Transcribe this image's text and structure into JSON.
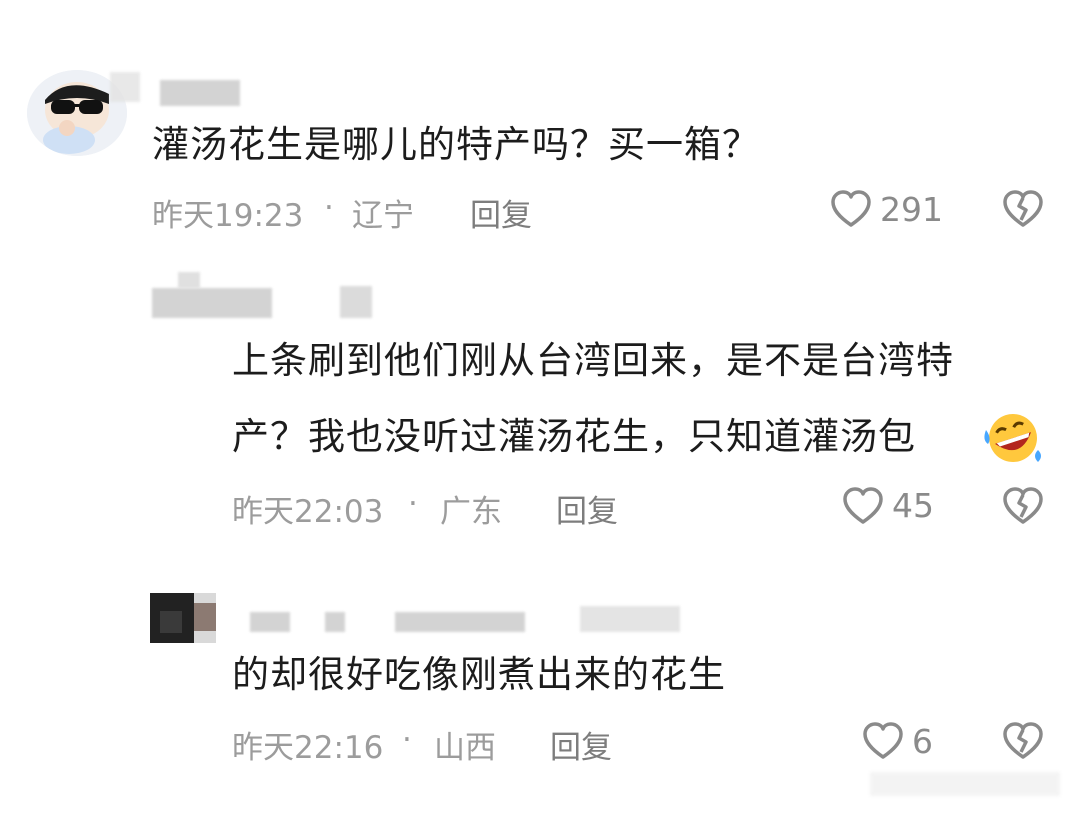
{
  "comments": [
    {
      "text_line1": "灌汤花生是哪儿的特产吗？买一箱？",
      "time": "昨天19:23",
      "location": "辽宁",
      "reply_label": "回复",
      "likes": "291"
    },
    {
      "text_line1": "上条刷到他们刚从台湾回来，是不是台湾特",
      "text_line2": "产？我也没听过灌汤花生，只知道灌汤包",
      "time": "昨天22:03",
      "location": "广东",
      "reply_label": "回复",
      "likes": "45"
    },
    {
      "text_line1": "的却很好吃像刚煮出来的花生",
      "time": "昨天22:16",
      "location": "山西",
      "reply_label": "回复",
      "likes": "6"
    }
  ],
  "separator": "·",
  "icons": {
    "like": "heart-outline-icon",
    "dislike": "broken-heart-icon",
    "emoji": "rolling-laughing-emoji-icon"
  },
  "colors": {
    "text": "#1c1c1c",
    "meta": "#9c9c9c",
    "icon": "#8a8a8a"
  }
}
